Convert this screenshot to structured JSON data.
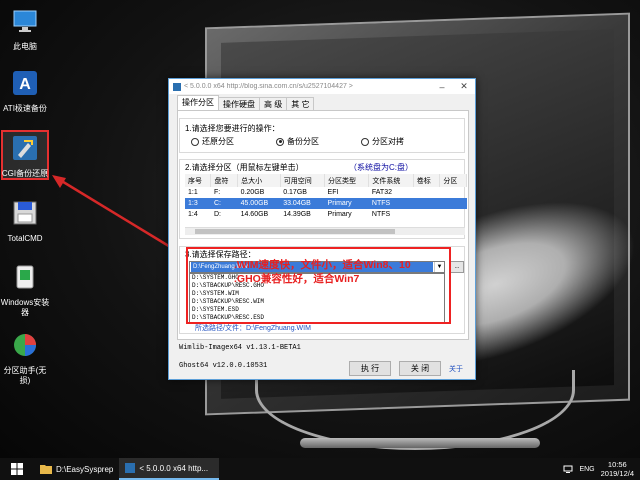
{
  "desktop": {
    "icons": [
      {
        "label": "此电脑"
      },
      {
        "label": "ATI极速备份"
      },
      {
        "label": "CGI备份还原"
      },
      {
        "label": "TotalCMD"
      },
      {
        "label": "Windows安装器"
      },
      {
        "label": "分区助手(无损)"
      }
    ]
  },
  "dialog": {
    "title": "< 5.0.0.0 x64 http://blog.sina.com.cn/s/u2527104427 >",
    "tabs": [
      "操作分区",
      "操作硬盘",
      "高 级",
      "其 它"
    ],
    "op_label": "1.请选择您要进行的操作：",
    "ops": [
      "还原分区",
      "备份分区",
      "分区对拷"
    ],
    "part_label": "2.请选择分区（用鼠标左键单击）",
    "system_disk": "（系统盘为C:盘）",
    "columns": [
      "序号",
      "盘符",
      "总大小",
      "可用空间",
      "分区类型",
      "文件系统",
      "卷标",
      "分区"
    ],
    "rows": [
      [
        "1:1",
        "F:",
        "0.20GB",
        "0.17GB",
        "EFI",
        "FAT32",
        "",
        ""
      ],
      [
        "1:3",
        "C:",
        "45.00GB",
        "33.04GB",
        "Primary",
        "NTFS",
        "",
        ""
      ],
      [
        "1:4",
        "D:",
        "14.60GB",
        "14.39GB",
        "Primary",
        "NTFS",
        "",
        ""
      ]
    ],
    "path_label": "3.请选择保存路径：",
    "path_value": "D:\\FengZhuang.WIM",
    "browse": "...",
    "path_options": [
      "D:\\SYSTEM.GHO",
      "D:\\STBACKUP\\RESC.GHO",
      "D:\\SYSTEM.WIM",
      "D:\\STBACKUP\\RESC.WIM",
      "D:\\SYSTEM.ESD",
      "D:\\STBACKUP\\RESC.ESD"
    ],
    "new_path": "所选路径/文件：D:\\FengZhuang.WIM",
    "annotation_line1": ".WIM速度快，文件小，适合Win8、10",
    "annotation_line2": ".GHO兼容性好，适合Win7",
    "wimlib": "Wimlib-Imagex64 v1.13.1-BETA1",
    "ghost": "Ghost64 v12.0.0.10531",
    "run_button": "执 行",
    "close_button": "关 闭",
    "about": "关于"
  },
  "taskbar": {
    "items": [
      "D:\\EasySysprep",
      "< 5.0.0.0 x64 http..."
    ],
    "lang": "ENG",
    "time": "10:56",
    "date": "2019/12/4"
  },
  "colors": {
    "highlight": "#3b7bd9",
    "annotation": "#e82020",
    "link": "#2050c0"
  }
}
